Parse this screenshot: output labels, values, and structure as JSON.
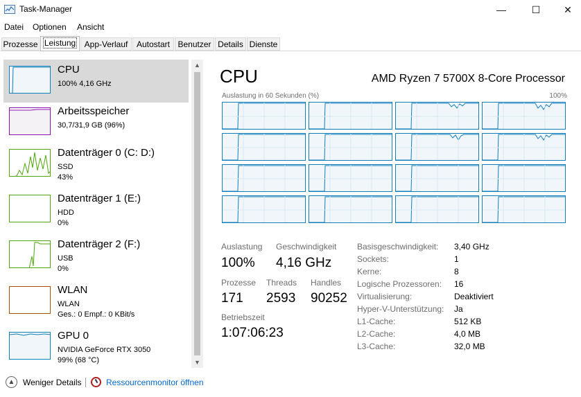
{
  "window": {
    "title": "Task-Manager",
    "minimize": "—",
    "maximize": "☐",
    "close": "✕"
  },
  "menu": [
    "Datei",
    "Optionen",
    "Ansicht"
  ],
  "tabs": [
    "Prozesse",
    "Leistung",
    "App-Verlauf",
    "Autostart",
    "Benutzer",
    "Details",
    "Dienste"
  ],
  "active_tab": "Leistung",
  "sidebar": {
    "items": [
      {
        "title": "CPU",
        "line1": "100% 4,16 GHz",
        "line2": "",
        "line3": "",
        "color": "#117dbb"
      },
      {
        "title": "Arbeitsspeicher",
        "line1": "30,7/31,9 GB (96%)",
        "line2": "",
        "line3": "",
        "color": "#8b12ae"
      },
      {
        "title": "Datenträger 0 (C: D:)",
        "line1": "SSD",
        "line2": "43%",
        "line3": "",
        "color": "#4da60c"
      },
      {
        "title": "Datenträger 1 (E:)",
        "line1": "HDD",
        "line2": "0%",
        "line3": "",
        "color": "#4da60c"
      },
      {
        "title": "Datenträger 2 (F:)",
        "line1": "USB",
        "line2": "0%",
        "line3": "",
        "color": "#4da60c"
      },
      {
        "title": "WLAN",
        "line1": "WLAN",
        "line2": "Ges.: 0 Empf.: 0 KBit/s",
        "line3": "",
        "color": "#a74f01"
      },
      {
        "title": "GPU 0",
        "line1": "NVIDIA GeForce RTX 3050",
        "line2": "99% (68 °C)",
        "line3": "",
        "color": "#117dbb"
      }
    ],
    "scroll_up": "▲",
    "scroll_down": "▼"
  },
  "main": {
    "title": "CPU",
    "model": "AMD Ryzen 7 5700X 8-Core Processor",
    "graph_label": "Auslastung in 60 Sekunden (%)",
    "graph_max": "100%",
    "stats": {
      "auslastung_label": "Auslastung",
      "auslastung_value": "100%",
      "geschwindigkeit_label": "Geschwindigkeit",
      "geschwindigkeit_value": "4,16 GHz",
      "prozesse_label": "Prozesse",
      "prozesse_value": "171",
      "threads_label": "Threads",
      "threads_value": "2593",
      "handles_label": "Handles",
      "handles_value": "90252",
      "betriebszeit_label": "Betriebszeit",
      "betriebszeit_value": "1:07:06:23"
    },
    "info": [
      {
        "label": "Basisgeschwindigkeit:",
        "value": "3,40 GHz"
      },
      {
        "label": "Sockets:",
        "value": "1"
      },
      {
        "label": "Kerne:",
        "value": "8"
      },
      {
        "label": "Logische Prozessoren:",
        "value": "16"
      },
      {
        "label": "Virtualisierung:",
        "value": "Deaktiviert"
      },
      {
        "label": "Hyper-V-Unterstützung:",
        "value": "Ja"
      },
      {
        "label": "L1-Cache:",
        "value": "512 KB"
      },
      {
        "label": "L2-Cache:",
        "value": "4,0 MB"
      },
      {
        "label": "L3-Cache:",
        "value": "32,0 MB"
      }
    ]
  },
  "footer": {
    "fewer_details": "Weniger Details",
    "resource_monitor": "Ressourcenmonitor öffnen"
  }
}
